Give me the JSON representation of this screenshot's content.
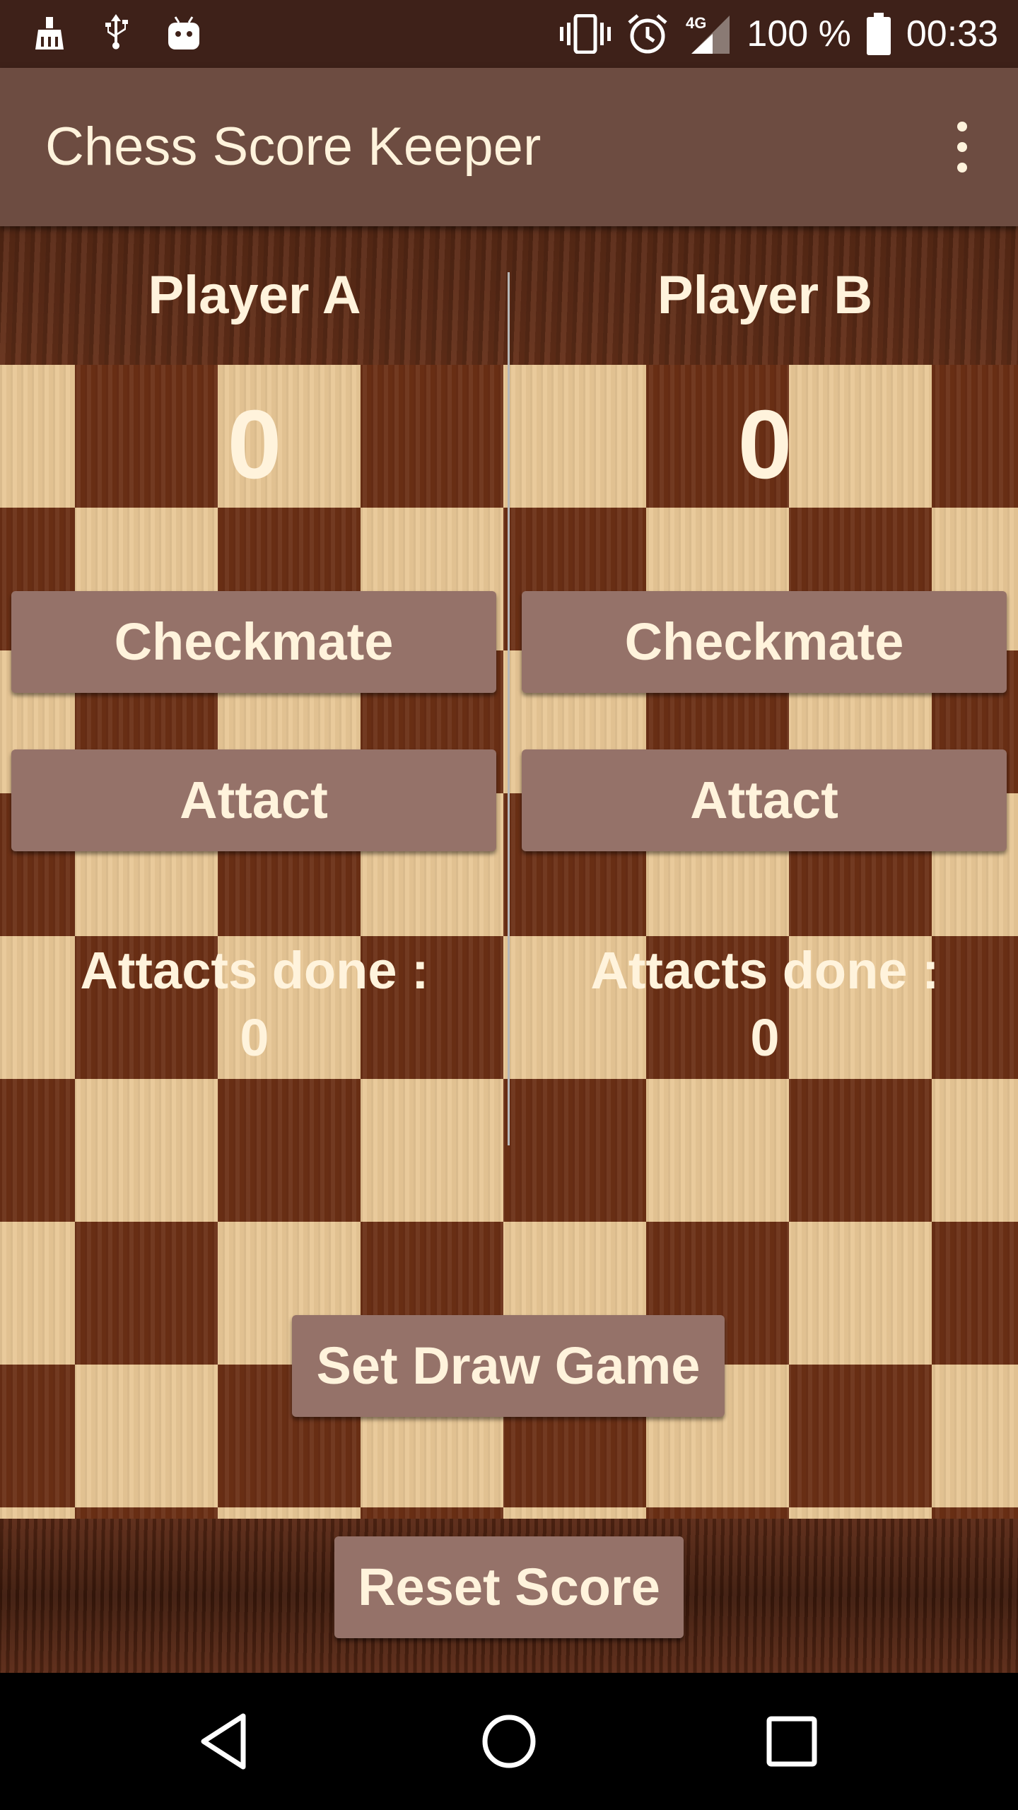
{
  "status_bar": {
    "battery_text": "100 %",
    "time": "00:33",
    "network_label": "4G",
    "left_icons": [
      "cleaner-icon",
      "usb-icon",
      "android-debug-icon"
    ],
    "right_icons": [
      "vibrate-icon",
      "alarm-icon",
      "signal-icon",
      "battery-icon"
    ]
  },
  "app_bar": {
    "title": "Chess Score Keeper",
    "menu_icon": "overflow-menu-icon"
  },
  "players": [
    {
      "name": "Player A",
      "score": "0",
      "checkmate_label": "Checkmate",
      "attack_label": "Attact",
      "attacks_done_label": "Attacts done :",
      "attacks_done_value": "0"
    },
    {
      "name": "Player B",
      "score": "0",
      "checkmate_label": "Checkmate",
      "attack_label": "Attact",
      "attacks_done_label": "Attacts done :",
      "attacks_done_value": "0"
    }
  ],
  "actions": {
    "draw_label": "Set Draw Game",
    "reset_label": "Reset Score"
  },
  "colors": {
    "status_bar": "#3e2119",
    "app_bar": "#6d4c41",
    "button": "#957269",
    "text_light": "#fff3dc"
  },
  "nav_bar": {
    "icons": [
      "back-icon",
      "home-icon",
      "recents-icon"
    ]
  }
}
